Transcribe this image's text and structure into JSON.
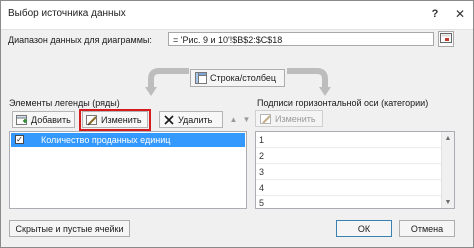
{
  "window": {
    "title": "Выбор источника данных",
    "help_glyph": "?",
    "close_glyph": "✕"
  },
  "range": {
    "label": "Диапазон данных для диаграммы:",
    "value": "= 'Рис. 9 и 10'!$B$2:$C$18"
  },
  "switch": {
    "label": "Строка/столбец"
  },
  "legend": {
    "title": "Элементы легенды (ряды)",
    "add_label": "Добавить",
    "edit_label": "Изменить",
    "delete_label": "Удалить",
    "up_glyph": "▲",
    "down_glyph": "▼",
    "items": [
      {
        "label": "Количество проданных единиц",
        "checked": true,
        "check_glyph": "✓"
      }
    ]
  },
  "axis": {
    "title": "Подписи горизонтальной оси (категории)",
    "edit_label": "Изменить",
    "items": [
      "1",
      "2",
      "3",
      "4",
      "5"
    ],
    "scroll_up_glyph": "▲",
    "scroll_down_glyph": "▼"
  },
  "footer": {
    "hidden_cells_label": "Скрытые и пустые ячейки",
    "ok_label": "ОК",
    "cancel_label": "Отмена"
  },
  "colors": {
    "selection": "#3399ff",
    "highlight_border": "#d51b20"
  }
}
